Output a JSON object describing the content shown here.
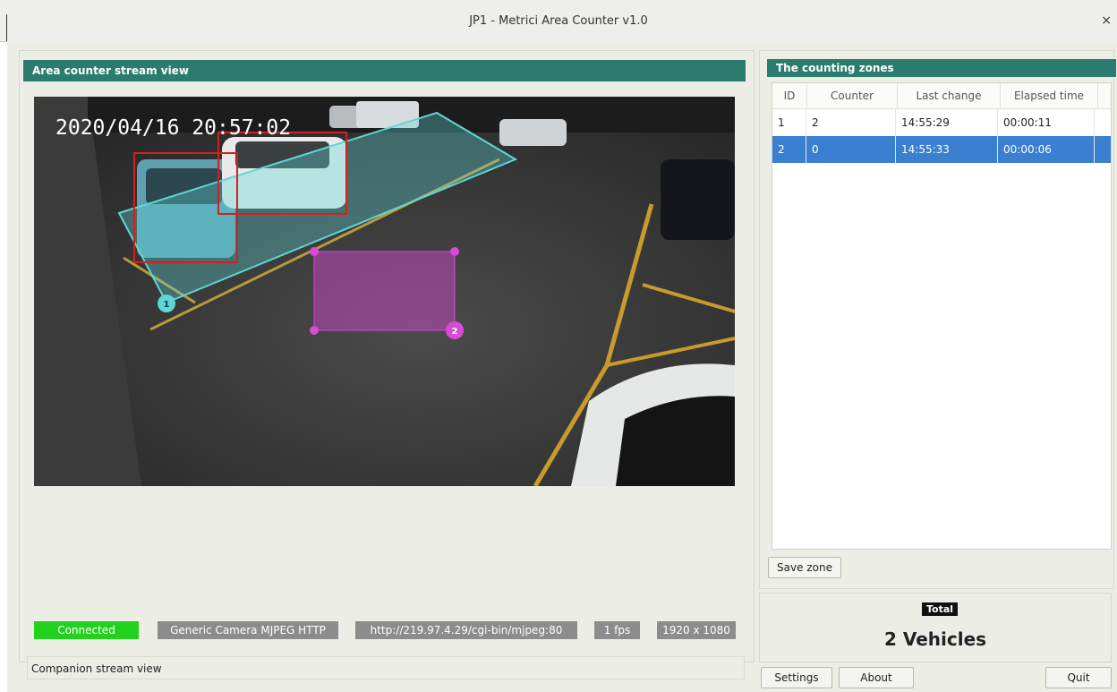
{
  "window": {
    "title": "JP1 - Metrici Area Counter v1.0",
    "close_glyph": "×"
  },
  "stream": {
    "header": "Area counter stream view",
    "timestamp": "2020/04/16 20:57:02",
    "zone_labels": [
      "1",
      "2"
    ],
    "status": {
      "connected": "Connected",
      "camera": "Generic Camera MJPEG HTTP",
      "url": "http://219.97.4.29/cgi-bin/mjpeg:80",
      "fps": "1 fps",
      "resolution": "1920 x 1080"
    },
    "companion": "Companion stream view"
  },
  "zones": {
    "header": "The counting zones",
    "columns": [
      "ID",
      "Counter",
      "Last change",
      "Elapsed time"
    ],
    "rows": [
      {
        "id": "1",
        "counter": "2",
        "last_change": "14:55:29",
        "elapsed": "00:00:11",
        "selected": false
      },
      {
        "id": "2",
        "counter": "0",
        "last_change": "14:55:33",
        "elapsed": "00:00:06",
        "selected": true
      }
    ],
    "save_button": "Save zone"
  },
  "total": {
    "label": "Total",
    "value": "2 Vehicles"
  },
  "buttons": {
    "settings": "Settings",
    "about": "About",
    "quit": "Quit"
  },
  "colors": {
    "header": "#2b7b6e",
    "connected": "#22d11e",
    "selection": "#3a7fd0",
    "zone1": "#5fd6d6",
    "zone2": "#d94ad6"
  }
}
